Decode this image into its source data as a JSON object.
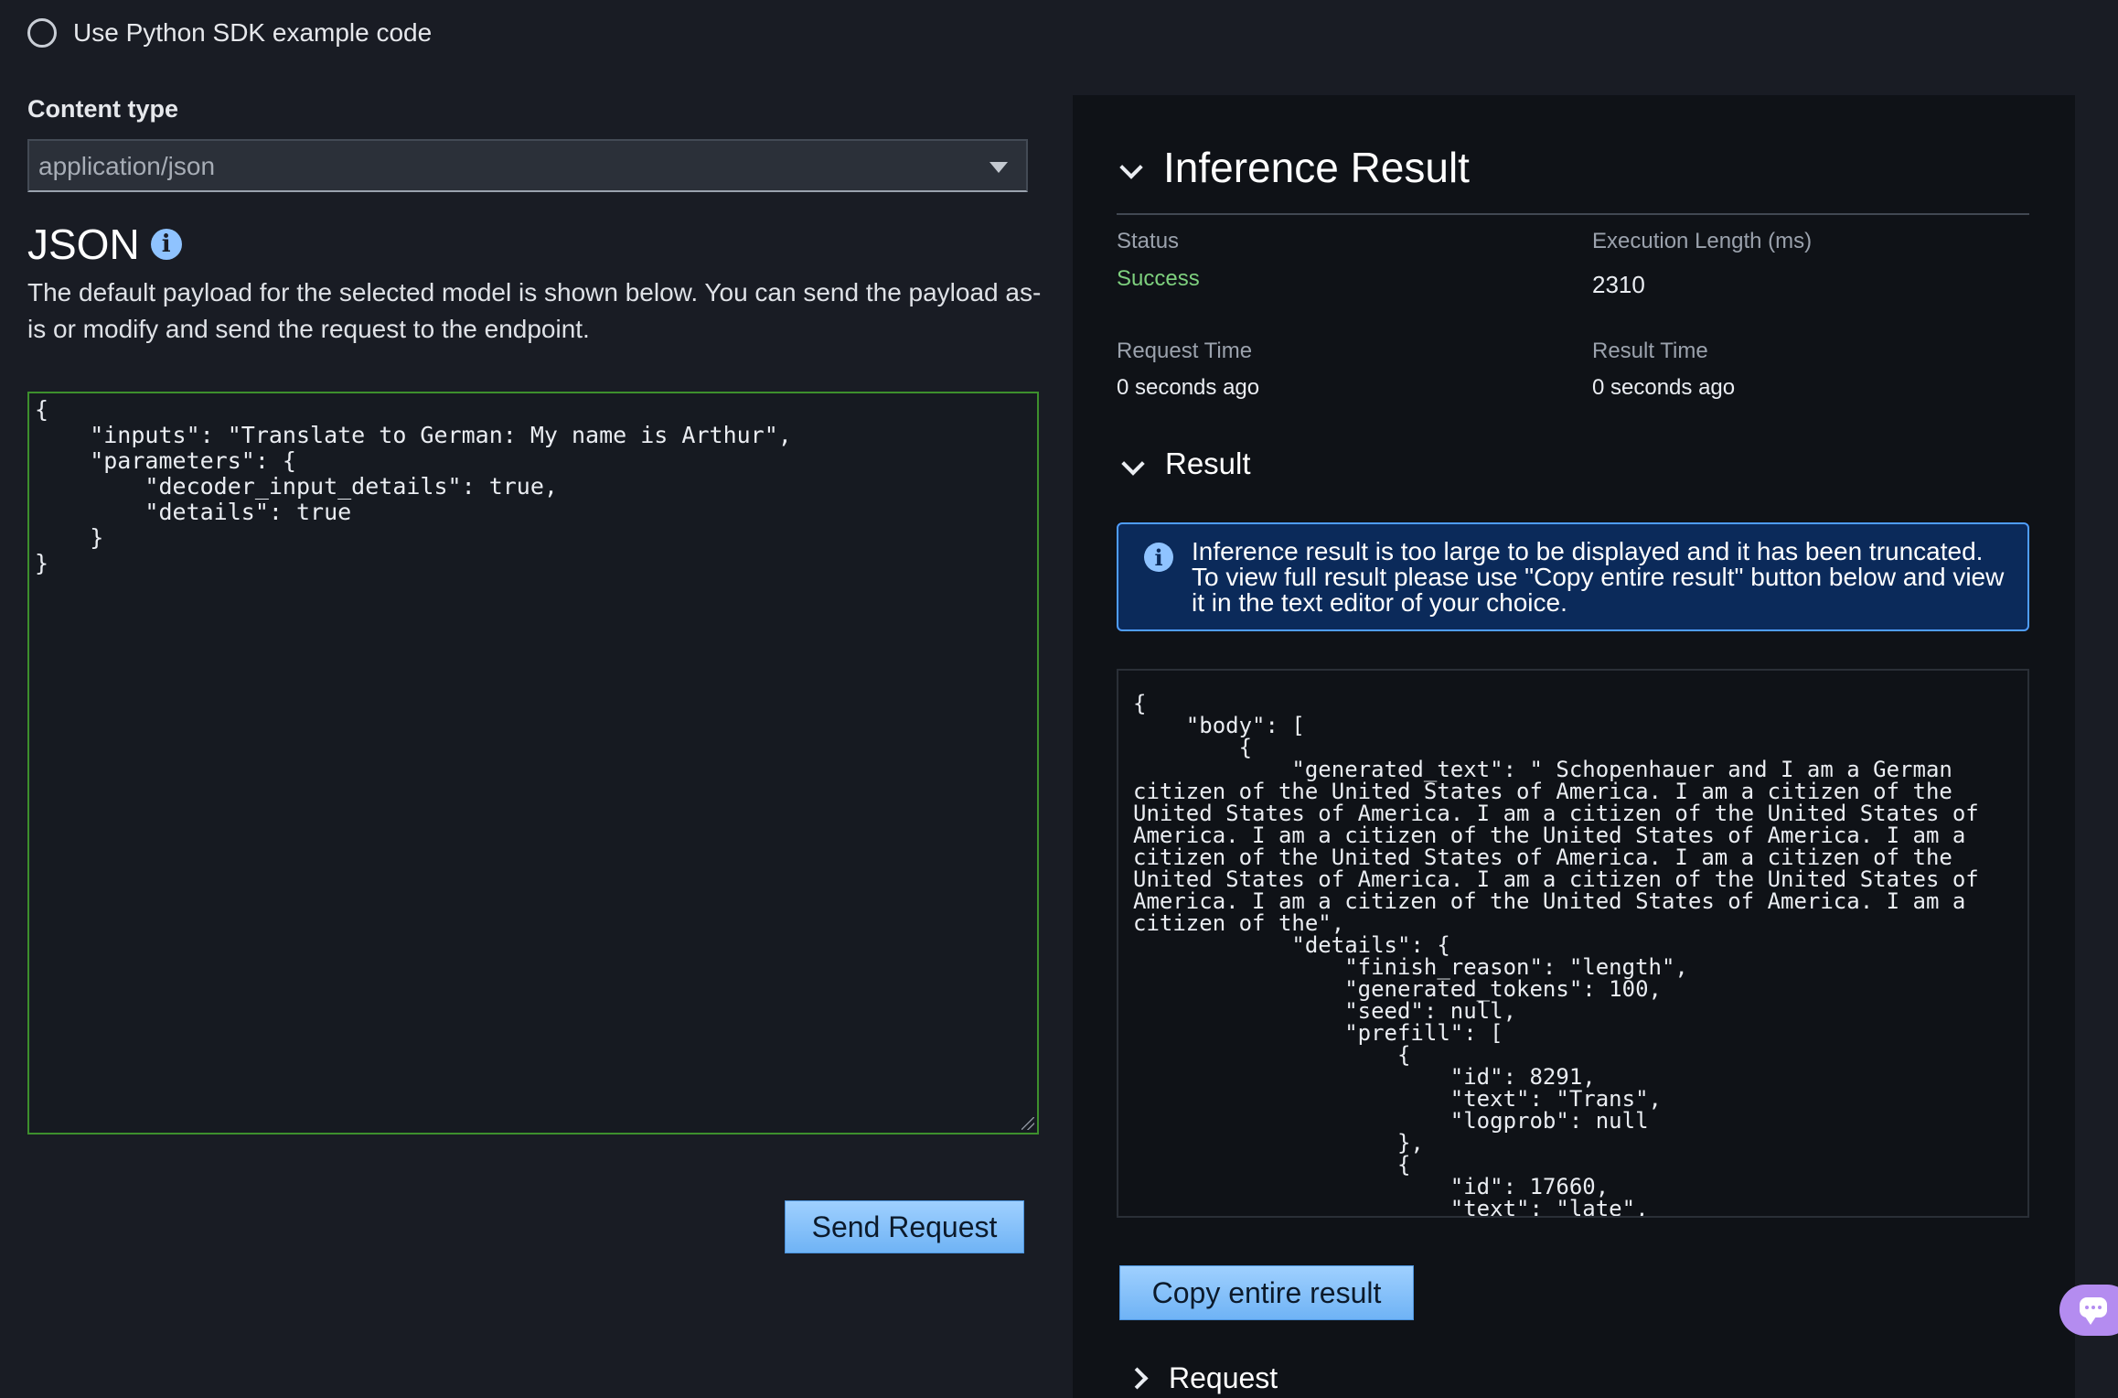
{
  "sdk_option": {
    "label": "Use Python SDK example code"
  },
  "content_type": {
    "label": "Content type",
    "value": "application/json"
  },
  "json_section": {
    "title": "JSON",
    "description": "The default payload for the selected model is shown below. You can send the payload as-is or modify and send the request to the endpoint.",
    "payload": "{\n    \"inputs\": \"Translate to German: My name is Arthur\",\n    \"parameters\": {\n        \"decoder_input_details\": true,\n        \"details\": true\n    }\n}"
  },
  "send_button": {
    "label": "Send Request"
  },
  "inference_result": {
    "title": "Inference Result",
    "status_label": "Status",
    "status_value": "Success",
    "exec_label": "Execution Length (ms)",
    "exec_value": "2310",
    "request_time_label": "Request Time",
    "request_time_value": "0 seconds ago",
    "result_time_label": "Result Time",
    "result_time_value": "0 seconds ago",
    "result_title": "Result",
    "alert_text": "Inference result is too large to be displayed and it has been truncated. To view full result please use \"Copy entire result\" button below and view it in the text editor of your choice.",
    "result_body": "{\n    \"body\": [\n        {\n            \"generated_text\": \" Schopenhauer and I am a German\ncitizen of the United States of America. I am a citizen of the\nUnited States of America. I am a citizen of the United States of\nAmerica. I am a citizen of the United States of America. I am a\ncitizen of the United States of America. I am a citizen of the\nUnited States of America. I am a citizen of the United States of\nAmerica. I am a citizen of the United States of America. I am a\ncitizen of the\",\n            \"details\": {\n                \"finish_reason\": \"length\",\n                \"generated_tokens\": 100,\n                \"seed\": null,\n                \"prefill\": [\n                    {\n                        \"id\": 8291,\n                        \"text\": \"Trans\",\n                        \"logprob\": null\n                    },\n                    {\n                        \"id\": 17660,\n                        \"text\": \"late\",",
    "copy_button": "Copy entire result",
    "request_title": "Request"
  },
  "icons": {
    "info": "info-icon",
    "chat": "chat-icon",
    "dropdown": "caret-down-icon"
  },
  "colors": {
    "background": "#191c24",
    "panel": "#0f1217",
    "accent_button": "#88c4fa",
    "success": "#7ed07e",
    "alert_bg": "#0b2a5a",
    "alert_border": "#4f9dff",
    "editor_border": "#3d8f2d"
  }
}
